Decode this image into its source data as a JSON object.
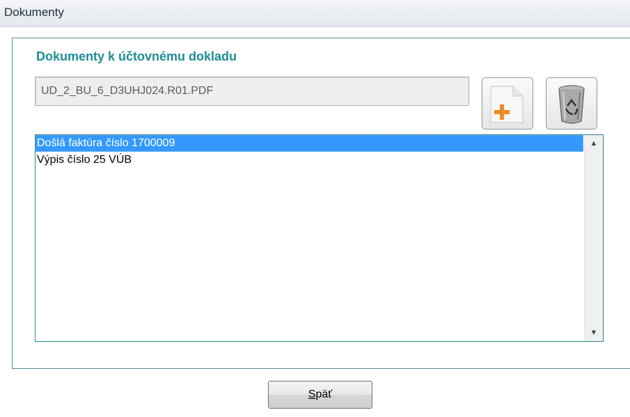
{
  "window": {
    "title": "Dokumenty"
  },
  "section": {
    "title": "Dokumenty k účtovnému dokladu"
  },
  "path_field": {
    "value": "UD_2_BU_6_D3UHJ024.R01.PDF"
  },
  "toolbar": {
    "add_icon": "add-document-icon",
    "delete_icon": "recycle-bin-icon",
    "accent_color": "#f08a24"
  },
  "documents": {
    "items": [
      {
        "label": "Došlá faktúra číslo 1700009",
        "selected": true
      },
      {
        "label": "Výpis číslo 25 VÚB",
        "selected": false
      }
    ]
  },
  "footer": {
    "back_button": {
      "mnemonic": "S",
      "rest": "päť"
    }
  }
}
